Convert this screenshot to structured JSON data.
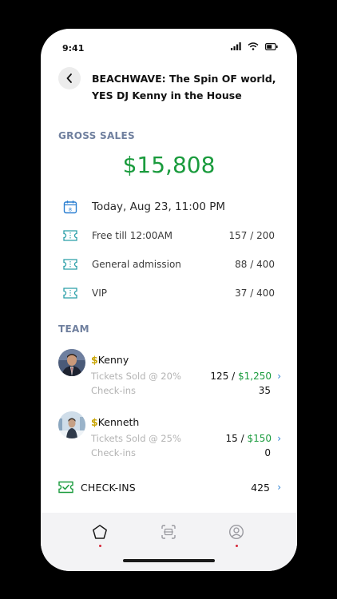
{
  "status": {
    "time": "9:41"
  },
  "header": {
    "title": "BEACHWAVE: The Spin OF world, YES DJ Kenny in the House"
  },
  "gross": {
    "label": "GROSS SALES",
    "value": "$15,808"
  },
  "date": {
    "text": "Today, Aug 23, 11:00 PM",
    "icon_day": "8"
  },
  "tickets": [
    {
      "name": "Free till 12:00AM",
      "count": "157 / 200"
    },
    {
      "name": "General admission",
      "count": "88 / 400"
    },
    {
      "name": "VIP",
      "count": "37 / 400"
    }
  ],
  "team": {
    "label": "TEAM",
    "members": [
      {
        "dollar": "$",
        "name": "Kenny",
        "sold_label": "Tickets Sold @ 20%",
        "sold_count": "125",
        "sold_sep": " / ",
        "sold_amount": "$1,250",
        "checkins_label": "Check-ins",
        "checkins": "35"
      },
      {
        "dollar": "$",
        "name": "Kenneth",
        "sold_label": "Tickets Sold @ 25%",
        "sold_count": "15",
        "sold_sep": " / ",
        "sold_amount": "$150",
        "checkins_label": "Check-ins",
        "checkins": "0"
      }
    ]
  },
  "checkins": {
    "label": "CHECK-INS",
    "count": "425"
  },
  "chevron": "›",
  "colors": {
    "accent_green": "#1a9b3d",
    "accent_blue": "#2a7fd1",
    "label_slate": "#6f7f9e",
    "dollar_gold": "#c8a400",
    "tab_dot_red": "#d6283a"
  },
  "icons": {
    "back": "chevron-left-icon",
    "calendar": "calendar-icon",
    "ticket": "ticket-icon",
    "checkins": "ticket-check-icon",
    "tabs": [
      "home-icon",
      "scan-icon",
      "profile-icon"
    ]
  }
}
